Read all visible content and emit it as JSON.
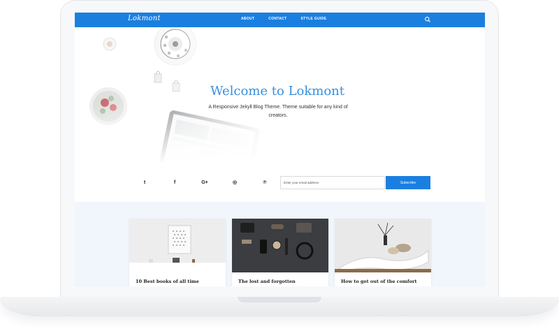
{
  "navbar": {
    "logo": "Lokmont",
    "links": [
      "ABOUT",
      "CONTACT",
      "STYLE GUIDE"
    ],
    "search_icon": "search-icon"
  },
  "hero": {
    "title": "Welcome to Lokmont",
    "subtitle": "A Responsive Jekyll Blog Theme. Theme suitable for any kind of creators."
  },
  "social": {
    "icons": [
      "twitter-icon",
      "facebook-icon",
      "google-plus-icon",
      "instagram-icon",
      "pinterest-icon"
    ],
    "glyphs": [
      "t",
      "f",
      "G+",
      "◎",
      "℗"
    ]
  },
  "subscribe": {
    "placeholder": "Enter your email address",
    "button_label": "Subscribe"
  },
  "posts": [
    {
      "title": "10 Best books of all time"
    },
    {
      "title": "The lost and forgotten"
    },
    {
      "title": "How to get out of the comfort"
    }
  ],
  "colors": {
    "accent": "#1b7fe0",
    "title_blue": "#3a8fdc",
    "posts_bg": "#f0f6fb"
  }
}
